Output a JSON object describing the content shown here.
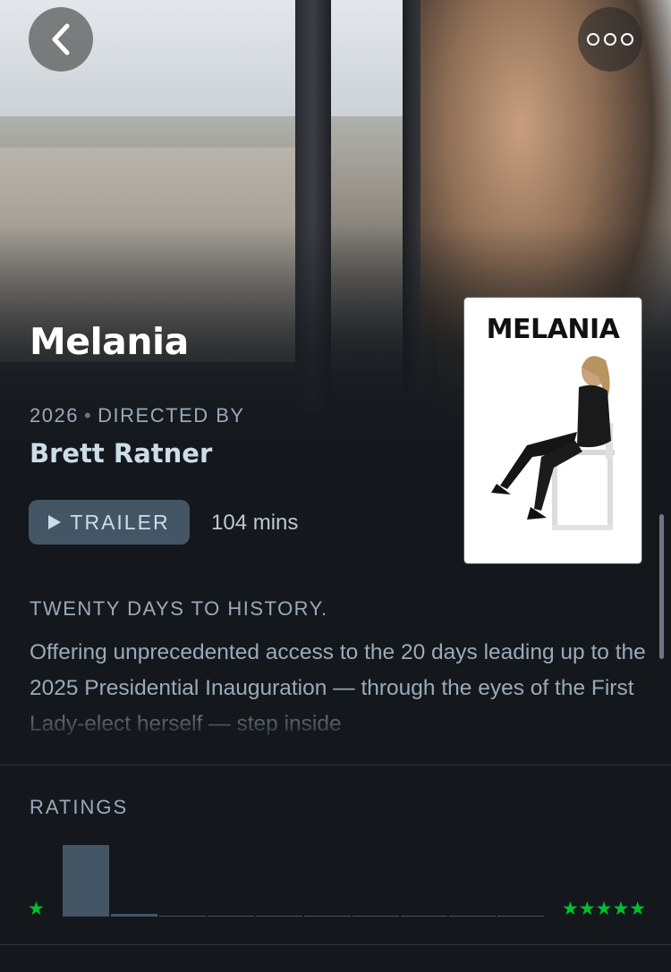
{
  "film": {
    "title": "Melania",
    "year": "2026",
    "directed_by_label": "DIRECTED BY",
    "director": "Brett Ratner",
    "trailer_label": "TRAILER",
    "runtime": "104 mins",
    "tagline": "TWENTY DAYS TO HISTORY.",
    "synopsis": "Offering unprecedented access to the 20 days leading up to the 2025 Presidential Inauguration — through the eyes of the First Lady-elect herself — step inside",
    "poster_title": "MELANIA"
  },
  "ratings": {
    "heading": "RATINGS",
    "low_label": "★",
    "high_label": "★★★★★",
    "accent_color": "#00c030",
    "histogram": [
      1.0,
      0.04,
      0.01,
      0.01,
      0.01,
      0.01,
      0.01,
      0.01,
      0.01,
      0.01
    ]
  },
  "icons": {
    "back": "chevron-left-icon",
    "more": "ellipsis-icon",
    "trailer": "play-icon"
  }
}
